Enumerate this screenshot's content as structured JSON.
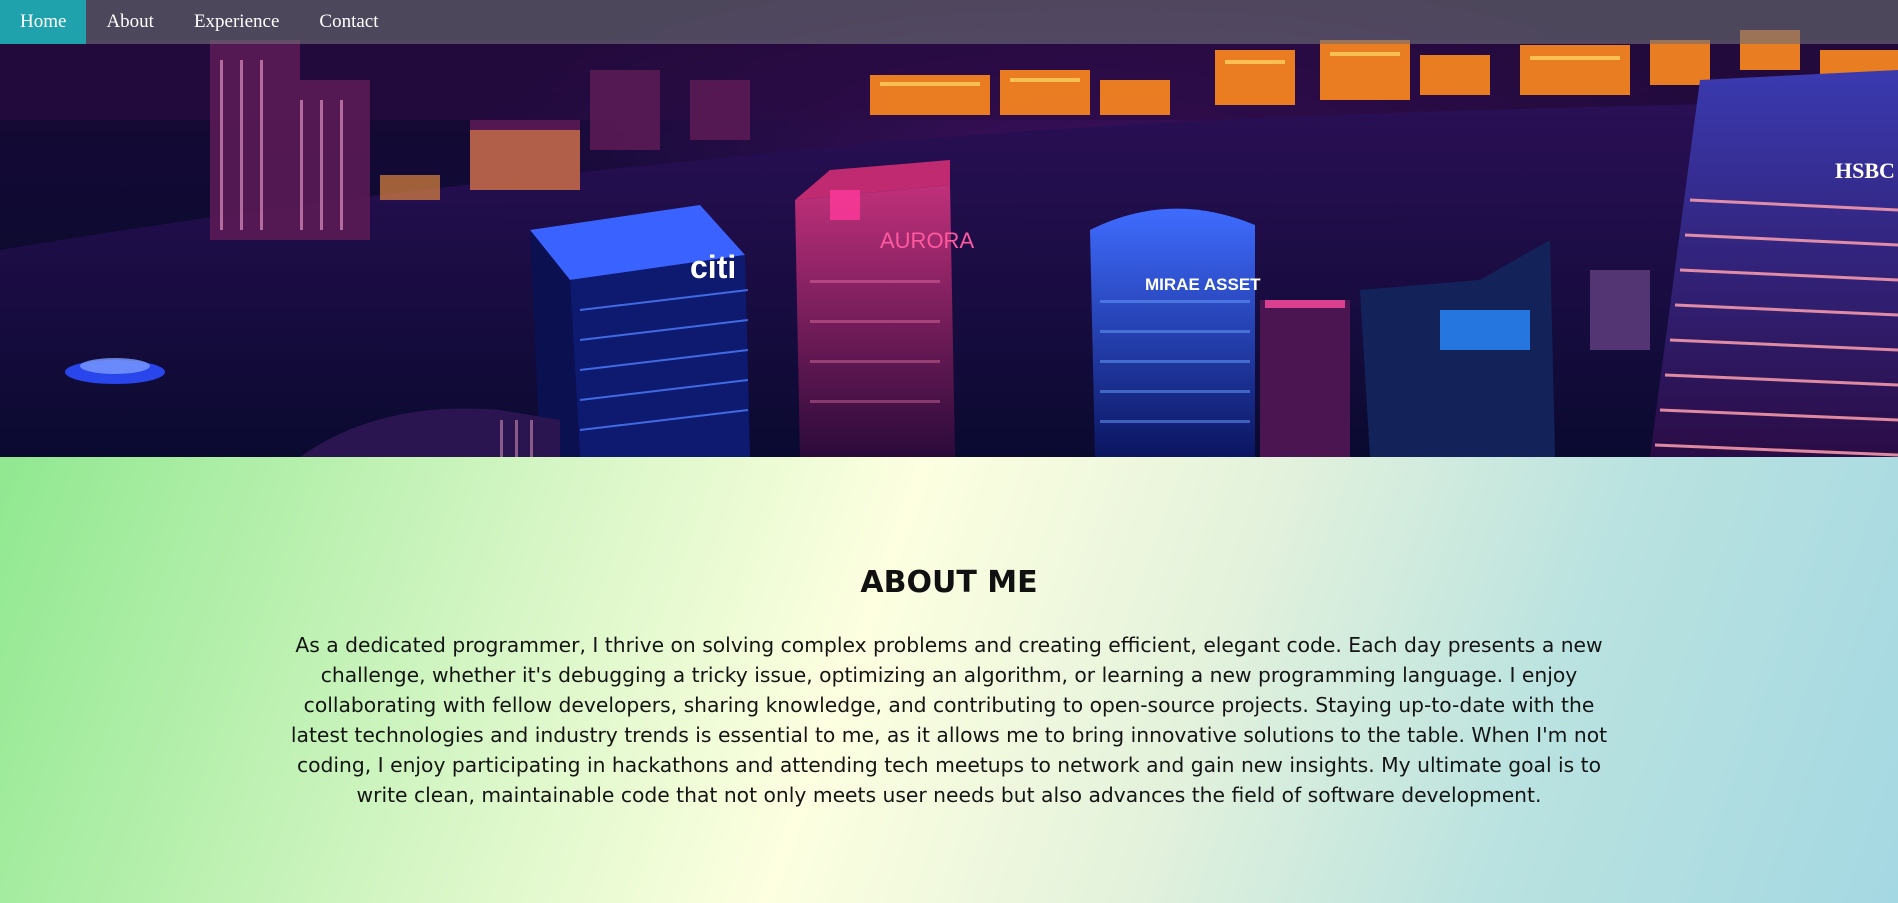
{
  "nav": {
    "items": [
      {
        "label": "Home",
        "active": true
      },
      {
        "label": "About",
        "active": false
      },
      {
        "label": "Experience",
        "active": false
      },
      {
        "label": "Contact",
        "active": false
      }
    ],
    "active_color": "#1fa2ab"
  },
  "hero": {
    "image": "night-city-skyline-photo",
    "signs": [
      "citi",
      "AURORA",
      "MIRAE ASSET",
      "HSBC"
    ]
  },
  "about": {
    "title": "ABOUT ME",
    "text": "As a dedicated programmer, I thrive on solving complex problems and creating efficient, elegant code. Each day presents a new challenge, whether it's debugging a tricky issue, optimizing an algorithm, or learning a new programming language. I enjoy collaborating with fellow developers, sharing knowledge, and contributing to open-source projects. Staying up-to-date with the latest technologies and industry trends is essential to me, as it allows me to bring innovative solutions to the table. When I'm not coding, I enjoy participating in hackathons and attending tech meetups to network and gain new insights. My ultimate goal is to write clean, maintainable code that not only meets user needs but also advances the field of software development."
  }
}
